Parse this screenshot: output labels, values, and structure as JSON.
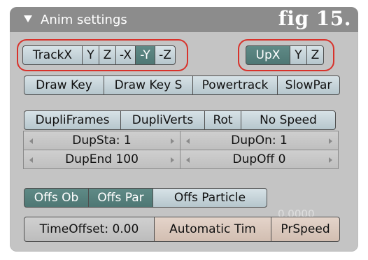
{
  "panel": {
    "title": "Anim settings",
    "fig_label": "fig 15."
  },
  "track": {
    "items": [
      "TrackX",
      "Y",
      "Z",
      "-X",
      "-Y",
      "-Z"
    ],
    "selected": "-Y"
  },
  "up": {
    "items": [
      "UpX",
      "Y",
      "Z"
    ],
    "selected": "UpX"
  },
  "keys": {
    "items": [
      "Draw Key",
      "Draw Key S",
      "Powertrack",
      "SlowPar"
    ]
  },
  "dupli": {
    "items": [
      "DupliFrames",
      "DupliVerts",
      "Rot",
      "No Speed"
    ]
  },
  "dup_fields": {
    "sta": "DupSta: 1",
    "on": "DupOn: 1",
    "end": "DupEnd 100",
    "off": "DupOff 0"
  },
  "offs": {
    "items": [
      "Offs Ob",
      "Offs Par",
      "Offs Particle"
    ],
    "value": "0.0000"
  },
  "time": {
    "offset": "TimeOffset: 0.00",
    "automatic": "Automatic Tim",
    "prspeed": "PrSpeed"
  },
  "colors": {
    "highlight": "#d8322b",
    "toggle_on": "#5f8a86",
    "header": "#8c8c8c"
  }
}
